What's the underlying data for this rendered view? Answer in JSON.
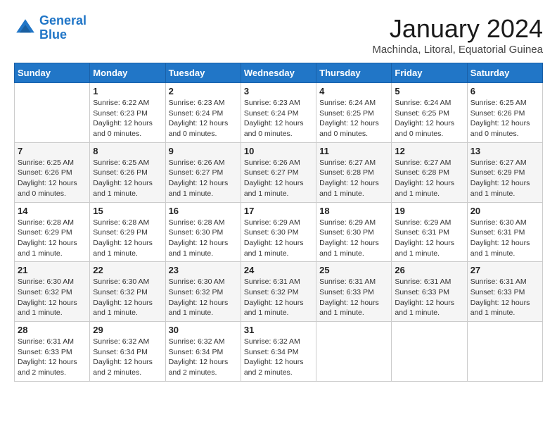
{
  "logo": {
    "line1": "General",
    "line2": "Blue"
  },
  "title": "January 2024",
  "subtitle": "Machinda, Litoral, Equatorial Guinea",
  "days_of_week": [
    "Sunday",
    "Monday",
    "Tuesday",
    "Wednesday",
    "Thursday",
    "Friday",
    "Saturday"
  ],
  "weeks": [
    [
      {
        "day": "",
        "info": ""
      },
      {
        "day": "1",
        "info": "Sunrise: 6:22 AM\nSunset: 6:23 PM\nDaylight: 12 hours\nand 0 minutes."
      },
      {
        "day": "2",
        "info": "Sunrise: 6:23 AM\nSunset: 6:24 PM\nDaylight: 12 hours\nand 0 minutes."
      },
      {
        "day": "3",
        "info": "Sunrise: 6:23 AM\nSunset: 6:24 PM\nDaylight: 12 hours\nand 0 minutes."
      },
      {
        "day": "4",
        "info": "Sunrise: 6:24 AM\nSunset: 6:25 PM\nDaylight: 12 hours\nand 0 minutes."
      },
      {
        "day": "5",
        "info": "Sunrise: 6:24 AM\nSunset: 6:25 PM\nDaylight: 12 hours\nand 0 minutes."
      },
      {
        "day": "6",
        "info": "Sunrise: 6:25 AM\nSunset: 6:26 PM\nDaylight: 12 hours\nand 0 minutes."
      }
    ],
    [
      {
        "day": "7",
        "info": "Sunrise: 6:25 AM\nSunset: 6:26 PM\nDaylight: 12 hours\nand 0 minutes."
      },
      {
        "day": "8",
        "info": "Sunrise: 6:25 AM\nSunset: 6:26 PM\nDaylight: 12 hours\nand 1 minute."
      },
      {
        "day": "9",
        "info": "Sunrise: 6:26 AM\nSunset: 6:27 PM\nDaylight: 12 hours\nand 1 minute."
      },
      {
        "day": "10",
        "info": "Sunrise: 6:26 AM\nSunset: 6:27 PM\nDaylight: 12 hours\nand 1 minute."
      },
      {
        "day": "11",
        "info": "Sunrise: 6:27 AM\nSunset: 6:28 PM\nDaylight: 12 hours\nand 1 minute."
      },
      {
        "day": "12",
        "info": "Sunrise: 6:27 AM\nSunset: 6:28 PM\nDaylight: 12 hours\nand 1 minute."
      },
      {
        "day": "13",
        "info": "Sunrise: 6:27 AM\nSunset: 6:29 PM\nDaylight: 12 hours\nand 1 minute."
      }
    ],
    [
      {
        "day": "14",
        "info": "Sunrise: 6:28 AM\nSunset: 6:29 PM\nDaylight: 12 hours\nand 1 minute."
      },
      {
        "day": "15",
        "info": "Sunrise: 6:28 AM\nSunset: 6:29 PM\nDaylight: 12 hours\nand 1 minute."
      },
      {
        "day": "16",
        "info": "Sunrise: 6:28 AM\nSunset: 6:30 PM\nDaylight: 12 hours\nand 1 minute."
      },
      {
        "day": "17",
        "info": "Sunrise: 6:29 AM\nSunset: 6:30 PM\nDaylight: 12 hours\nand 1 minute."
      },
      {
        "day": "18",
        "info": "Sunrise: 6:29 AM\nSunset: 6:30 PM\nDaylight: 12 hours\nand 1 minute."
      },
      {
        "day": "19",
        "info": "Sunrise: 6:29 AM\nSunset: 6:31 PM\nDaylight: 12 hours\nand 1 minute."
      },
      {
        "day": "20",
        "info": "Sunrise: 6:30 AM\nSunset: 6:31 PM\nDaylight: 12 hours\nand 1 minute."
      }
    ],
    [
      {
        "day": "21",
        "info": "Sunrise: 6:30 AM\nSunset: 6:32 PM\nDaylight: 12 hours\nand 1 minute."
      },
      {
        "day": "22",
        "info": "Sunrise: 6:30 AM\nSunset: 6:32 PM\nDaylight: 12 hours\nand 1 minute."
      },
      {
        "day": "23",
        "info": "Sunrise: 6:30 AM\nSunset: 6:32 PM\nDaylight: 12 hours\nand 1 minute."
      },
      {
        "day": "24",
        "info": "Sunrise: 6:31 AM\nSunset: 6:32 PM\nDaylight: 12 hours\nand 1 minute."
      },
      {
        "day": "25",
        "info": "Sunrise: 6:31 AM\nSunset: 6:33 PM\nDaylight: 12 hours\nand 1 minute."
      },
      {
        "day": "26",
        "info": "Sunrise: 6:31 AM\nSunset: 6:33 PM\nDaylight: 12 hours\nand 1 minute."
      },
      {
        "day": "27",
        "info": "Sunrise: 6:31 AM\nSunset: 6:33 PM\nDaylight: 12 hours\nand 1 minute."
      }
    ],
    [
      {
        "day": "28",
        "info": "Sunrise: 6:31 AM\nSunset: 6:33 PM\nDaylight: 12 hours\nand 2 minutes."
      },
      {
        "day": "29",
        "info": "Sunrise: 6:32 AM\nSunset: 6:34 PM\nDaylight: 12 hours\nand 2 minutes."
      },
      {
        "day": "30",
        "info": "Sunrise: 6:32 AM\nSunset: 6:34 PM\nDaylight: 12 hours\nand 2 minutes."
      },
      {
        "day": "31",
        "info": "Sunrise: 6:32 AM\nSunset: 6:34 PM\nDaylight: 12 hours\nand 2 minutes."
      },
      {
        "day": "",
        "info": ""
      },
      {
        "day": "",
        "info": ""
      },
      {
        "day": "",
        "info": ""
      }
    ]
  ]
}
